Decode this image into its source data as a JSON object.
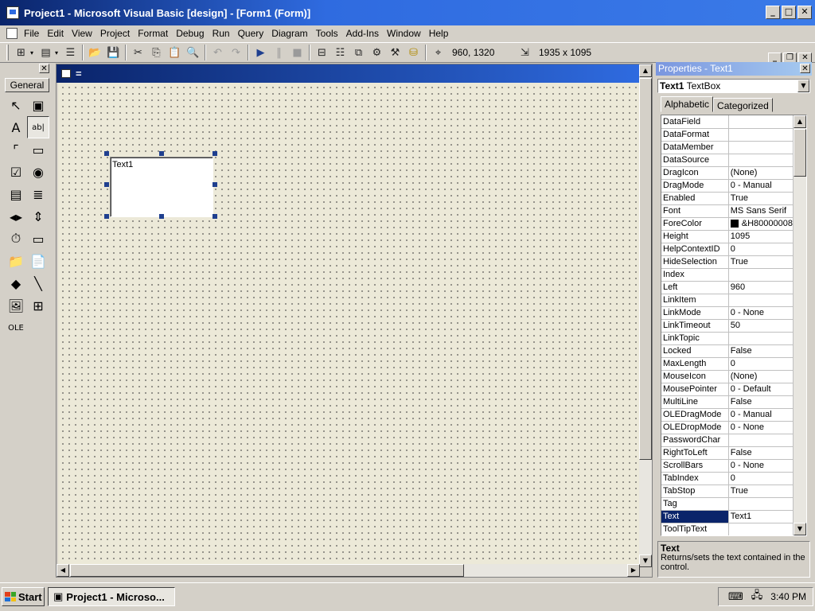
{
  "titlebar": {
    "title": "Project1 - Microsoft Visual Basic [design] - [Form1 (Form)]",
    "minimize": "_",
    "maximize": "□",
    "close": "✕"
  },
  "menubar": {
    "items": [
      "File",
      "Edit",
      "View",
      "Project",
      "Format",
      "Debug",
      "Run",
      "Query",
      "Diagram",
      "Tools",
      "Add-Ins",
      "Window",
      "Help"
    ],
    "doc_minimize": "_",
    "doc_restore": "❐",
    "doc_close": "✕"
  },
  "toolbar": {
    "position": "960, 1320",
    "size": "1935 x 1095",
    "icons": {
      "add_project": "⊞",
      "add_form": "▤",
      "menu_editor": "☰",
      "open": "📂",
      "save": "💾",
      "cut": "✂",
      "copy": "⎘",
      "paste": "📋",
      "find": "🔍",
      "undo": "↶",
      "redo": "↷",
      "start": "▶",
      "break": "‖",
      "end": "■",
      "project_explorer": "⊟",
      "properties_window": "☷",
      "form_layout": "⧉",
      "object_browser": "⚙",
      "toolbox": "⚒",
      "data_view": "⛁",
      "position_icon": "⌖",
      "size_icon": "⇲"
    }
  },
  "toolbox": {
    "close": "✕",
    "tab_label": "General",
    "tools": [
      {
        "name": "pointer-icon",
        "glyph": "↖"
      },
      {
        "name": "picturebox-icon",
        "glyph": "▣"
      },
      {
        "name": "label-icon",
        "glyph": "A"
      },
      {
        "name": "textbox-icon",
        "glyph": "ab|"
      },
      {
        "name": "frame-icon",
        "glyph": "⌜"
      },
      {
        "name": "commandbutton-icon",
        "glyph": "▭"
      },
      {
        "name": "checkbox-icon",
        "glyph": "☑"
      },
      {
        "name": "optionbutton-icon",
        "glyph": "◉"
      },
      {
        "name": "combobox-icon",
        "glyph": "▤"
      },
      {
        "name": "listbox-icon",
        "glyph": "≣"
      },
      {
        "name": "hscrollbar-icon",
        "glyph": "◂▸"
      },
      {
        "name": "vscrollbar-icon",
        "glyph": "⇕"
      },
      {
        "name": "timer-icon",
        "glyph": "⏱"
      },
      {
        "name": "drivelistbox-icon",
        "glyph": "▭"
      },
      {
        "name": "dirlistbox-icon",
        "glyph": "📁"
      },
      {
        "name": "filelistbox-icon",
        "glyph": "📄"
      },
      {
        "name": "shape-icon",
        "glyph": "◆"
      },
      {
        "name": "line-icon",
        "glyph": "╲"
      },
      {
        "name": "image-icon",
        "glyph": "🖼"
      },
      {
        "name": "data-icon",
        "glyph": "⊞"
      },
      {
        "name": "ole-icon",
        "glyph": "OLE"
      }
    ]
  },
  "designer": {
    "form_caption": "=",
    "textbox_text": "Text1",
    "scroll_up": "▲",
    "scroll_down": "▼",
    "scroll_left": "◀",
    "scroll_right": "▶"
  },
  "properties": {
    "title": "Properties - Text1",
    "close": "✕",
    "object_name": "Text1",
    "object_type": "TextBox",
    "combo_arrow": "▼",
    "tabs": [
      "Alphabetic",
      "Categorized"
    ],
    "rows": [
      {
        "name": "DataField",
        "value": ""
      },
      {
        "name": "DataFormat",
        "value": ""
      },
      {
        "name": "DataMember",
        "value": ""
      },
      {
        "name": "DataSource",
        "value": ""
      },
      {
        "name": "DragIcon",
        "value": "(None)"
      },
      {
        "name": "DragMode",
        "value": "0 - Manual"
      },
      {
        "name": "Enabled",
        "value": "True"
      },
      {
        "name": "Font",
        "value": "MS Sans Serif"
      },
      {
        "name": "ForeColor",
        "value": "&H80000008"
      },
      {
        "name": "Height",
        "value": "1095"
      },
      {
        "name": "HelpContextID",
        "value": "0"
      },
      {
        "name": "HideSelection",
        "value": "True"
      },
      {
        "name": "Index",
        "value": ""
      },
      {
        "name": "Left",
        "value": "960"
      },
      {
        "name": "LinkItem",
        "value": ""
      },
      {
        "name": "LinkMode",
        "value": "0 - None"
      },
      {
        "name": "LinkTimeout",
        "value": "50"
      },
      {
        "name": "LinkTopic",
        "value": ""
      },
      {
        "name": "Locked",
        "value": "False"
      },
      {
        "name": "MaxLength",
        "value": "0"
      },
      {
        "name": "MouseIcon",
        "value": "(None)"
      },
      {
        "name": "MousePointer",
        "value": "0 - Default"
      },
      {
        "name": "MultiLine",
        "value": "False"
      },
      {
        "name": "OLEDragMode",
        "value": "0 - Manual"
      },
      {
        "name": "OLEDropMode",
        "value": "0 - None"
      },
      {
        "name": "PasswordChar",
        "value": ""
      },
      {
        "name": "RightToLeft",
        "value": "False"
      },
      {
        "name": "ScrollBars",
        "value": "0 - None"
      },
      {
        "name": "TabIndex",
        "value": "0"
      },
      {
        "name": "TabStop",
        "value": "True"
      },
      {
        "name": "Tag",
        "value": ""
      },
      {
        "name": "Text",
        "value": "Text1",
        "selected": true
      },
      {
        "name": "ToolTipText",
        "value": ""
      }
    ],
    "scroll_up": "▲",
    "scroll_down": "▼",
    "desc_title": "Text",
    "desc_text": "Returns/sets the text contained in the control."
  },
  "taskbar": {
    "start_label": "Start",
    "task_label": "Project1 - Microso...",
    "clock": "3:40 PM"
  }
}
